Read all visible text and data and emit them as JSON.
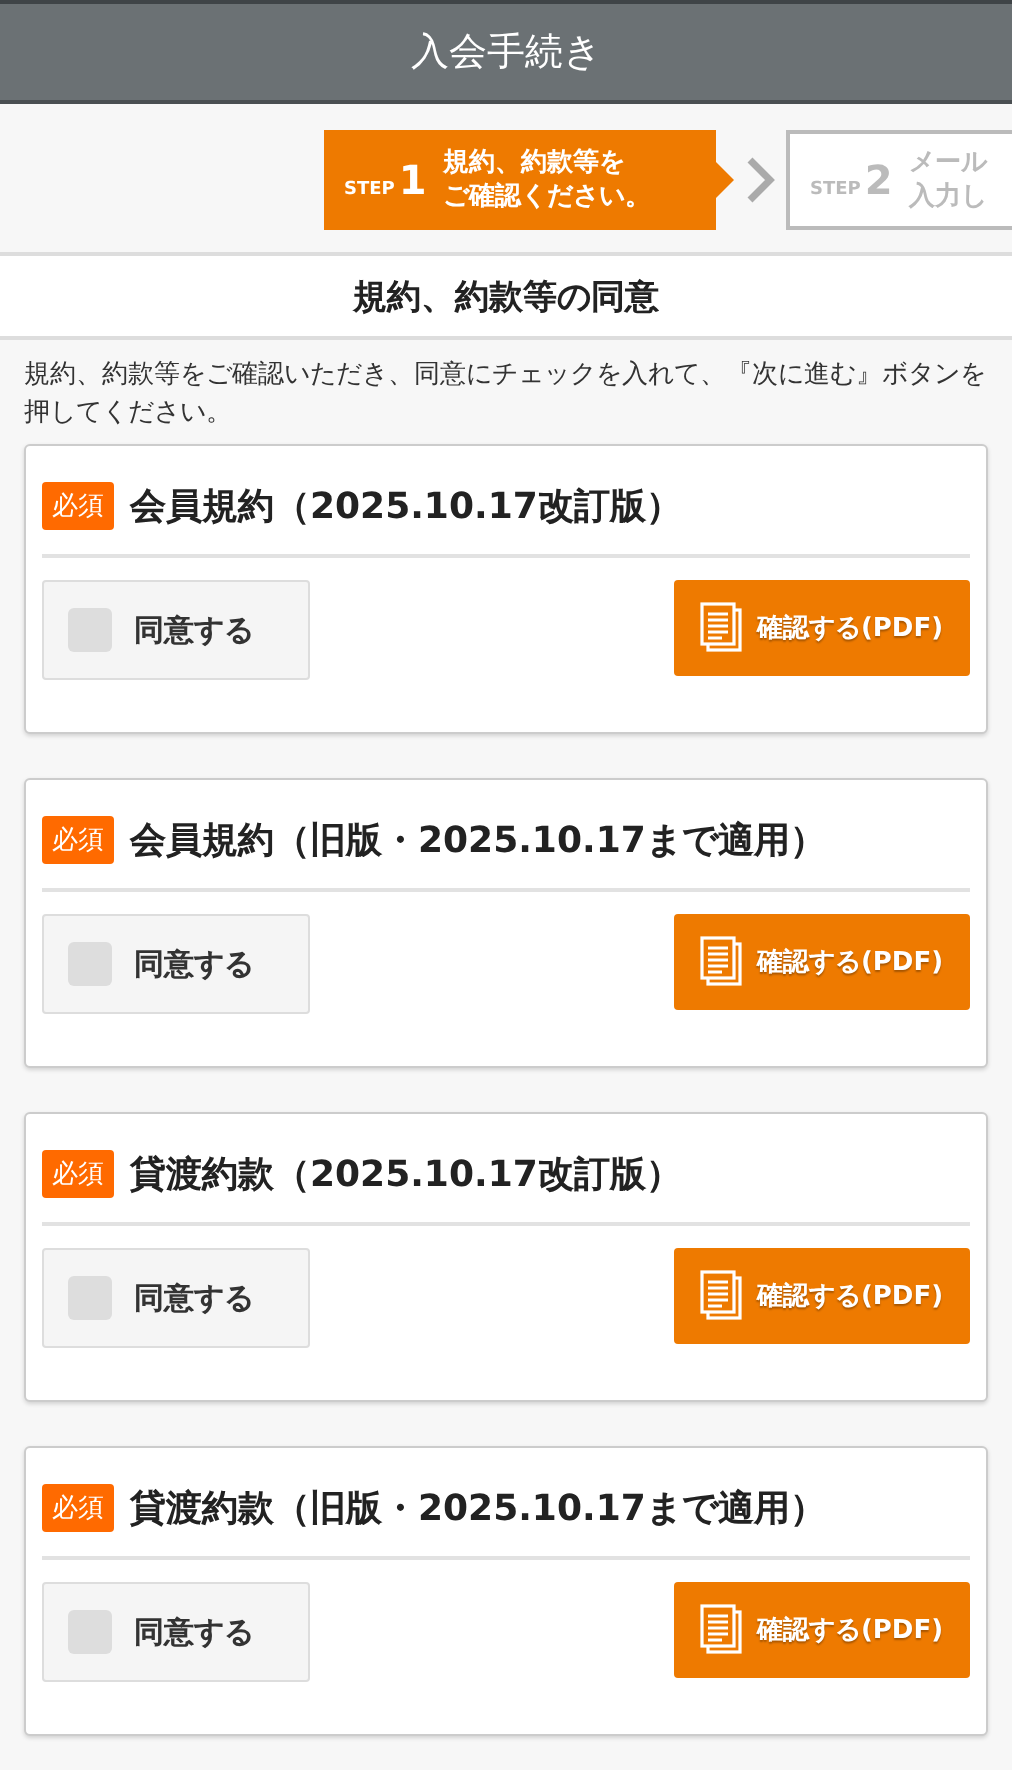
{
  "header": {
    "title": "入会手続き"
  },
  "steps": [
    {
      "label": "STEP",
      "number": "1",
      "lines": [
        "規約、約款等を",
        "ご確認ください。"
      ],
      "selected": true
    },
    {
      "label": "STEP",
      "number": "2",
      "lines": [
        "メール",
        "入力し"
      ],
      "selected": false
    }
  ],
  "section": {
    "title": "規約、約款等の同意",
    "description": "規約、約款等をご確認いただき、同意にチェックを入れて、『次に進む』ボタンを押してください。"
  },
  "agreements": [
    {
      "badge": "必須",
      "title": "会員規約（2025.10.17改訂版）",
      "agree": {
        "label": "同意する",
        "checked": false
      },
      "button": "確認する(PDF)"
    },
    {
      "badge": "必須",
      "title": "会員規約（旧版・2025.10.17まで適用）",
      "agree": {
        "label": "同意する",
        "checked": false
      },
      "button": "確認する(PDF)"
    },
    {
      "badge": "必須",
      "title": "貸渡約款（2025.10.17改訂版）",
      "agree": {
        "label": "同意する",
        "checked": false
      },
      "button": "確認する(PDF)"
    },
    {
      "badge": "必須",
      "title": "貸渡約款（旧版・2025.10.17まで適用）",
      "agree": {
        "label": "同意する",
        "checked": false
      },
      "button": "確認する(PDF)"
    }
  ]
}
